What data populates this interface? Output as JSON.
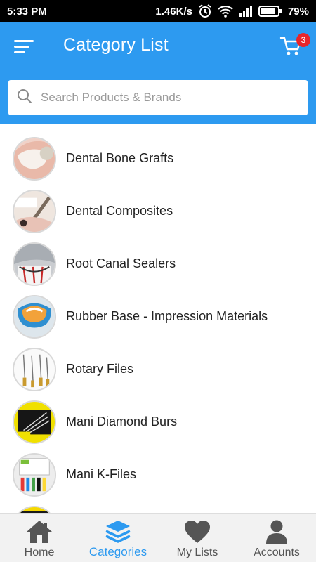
{
  "status_bar": {
    "time": "5:33 PM",
    "speed": "1.46K/s",
    "battery": "79%"
  },
  "header": {
    "title": "Category List",
    "cart_count": "3",
    "menu_icon": "hamburger-menu-icon",
    "cart_icon": "cart-icon"
  },
  "search": {
    "placeholder": "Search Products & Brands",
    "value": ""
  },
  "categories": [
    {
      "label": "Dental Bone Grafts"
    },
    {
      "label": "Dental Composites"
    },
    {
      "label": "Root Canal Sealers"
    },
    {
      "label": "Rubber Base - Impression Materials"
    },
    {
      "label": "Rotary Files"
    },
    {
      "label": "Mani Diamond Burs"
    },
    {
      "label": "Mani K-Files"
    }
  ],
  "bottom_nav": [
    {
      "label": "Home",
      "icon": "home-icon",
      "active": false
    },
    {
      "label": "Categories",
      "icon": "layers-icon",
      "active": true
    },
    {
      "label": "My Lists",
      "icon": "heart-icon",
      "active": false
    },
    {
      "label": "Accounts",
      "icon": "user-icon",
      "active": false
    }
  ],
  "colors": {
    "primary": "#2d9af0",
    "badge": "#e8252b",
    "status_bar": "#000000",
    "nav_inactive": "#555555"
  }
}
